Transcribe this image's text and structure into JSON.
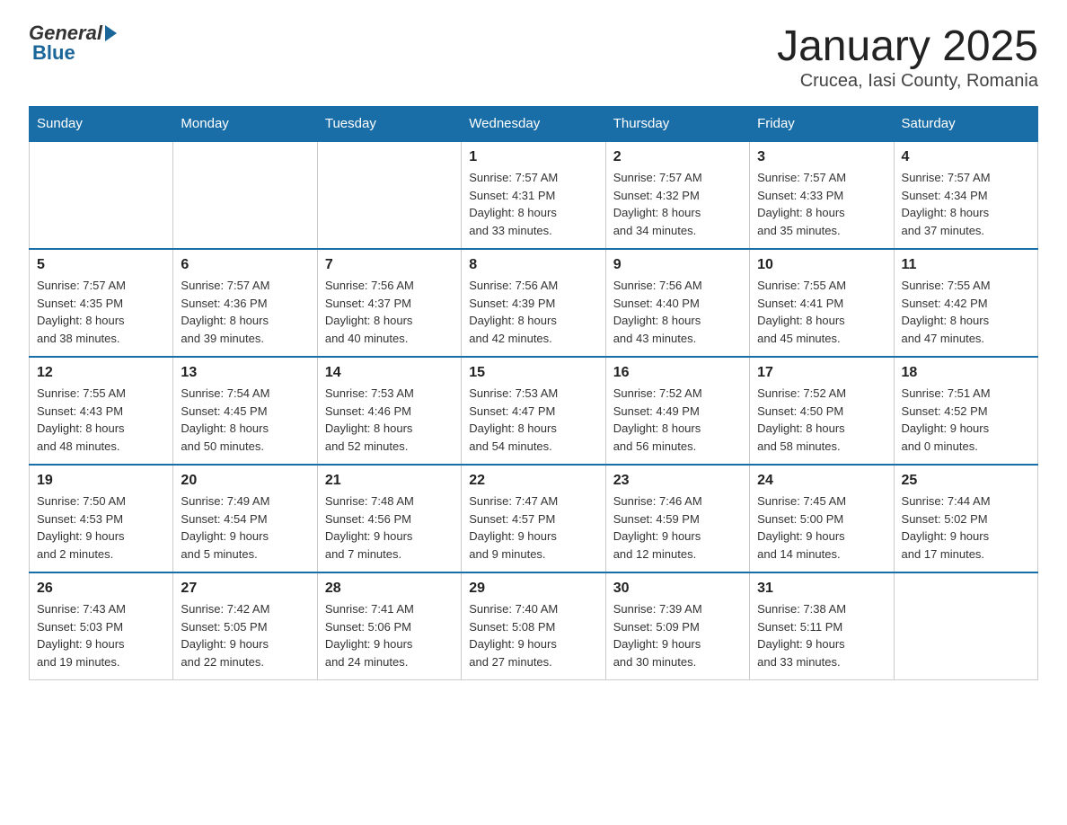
{
  "header": {
    "logo_general": "General",
    "logo_blue": "Blue",
    "title": "January 2025",
    "subtitle": "Crucea, Iasi County, Romania"
  },
  "days_of_week": [
    "Sunday",
    "Monday",
    "Tuesday",
    "Wednesday",
    "Thursday",
    "Friday",
    "Saturday"
  ],
  "weeks": [
    [
      {
        "day": "",
        "info": ""
      },
      {
        "day": "",
        "info": ""
      },
      {
        "day": "",
        "info": ""
      },
      {
        "day": "1",
        "info": "Sunrise: 7:57 AM\nSunset: 4:31 PM\nDaylight: 8 hours\nand 33 minutes."
      },
      {
        "day": "2",
        "info": "Sunrise: 7:57 AM\nSunset: 4:32 PM\nDaylight: 8 hours\nand 34 minutes."
      },
      {
        "day": "3",
        "info": "Sunrise: 7:57 AM\nSunset: 4:33 PM\nDaylight: 8 hours\nand 35 minutes."
      },
      {
        "day": "4",
        "info": "Sunrise: 7:57 AM\nSunset: 4:34 PM\nDaylight: 8 hours\nand 37 minutes."
      }
    ],
    [
      {
        "day": "5",
        "info": "Sunrise: 7:57 AM\nSunset: 4:35 PM\nDaylight: 8 hours\nand 38 minutes."
      },
      {
        "day": "6",
        "info": "Sunrise: 7:57 AM\nSunset: 4:36 PM\nDaylight: 8 hours\nand 39 minutes."
      },
      {
        "day": "7",
        "info": "Sunrise: 7:56 AM\nSunset: 4:37 PM\nDaylight: 8 hours\nand 40 minutes."
      },
      {
        "day": "8",
        "info": "Sunrise: 7:56 AM\nSunset: 4:39 PM\nDaylight: 8 hours\nand 42 minutes."
      },
      {
        "day": "9",
        "info": "Sunrise: 7:56 AM\nSunset: 4:40 PM\nDaylight: 8 hours\nand 43 minutes."
      },
      {
        "day": "10",
        "info": "Sunrise: 7:55 AM\nSunset: 4:41 PM\nDaylight: 8 hours\nand 45 minutes."
      },
      {
        "day": "11",
        "info": "Sunrise: 7:55 AM\nSunset: 4:42 PM\nDaylight: 8 hours\nand 47 minutes."
      }
    ],
    [
      {
        "day": "12",
        "info": "Sunrise: 7:55 AM\nSunset: 4:43 PM\nDaylight: 8 hours\nand 48 minutes."
      },
      {
        "day": "13",
        "info": "Sunrise: 7:54 AM\nSunset: 4:45 PM\nDaylight: 8 hours\nand 50 minutes."
      },
      {
        "day": "14",
        "info": "Sunrise: 7:53 AM\nSunset: 4:46 PM\nDaylight: 8 hours\nand 52 minutes."
      },
      {
        "day": "15",
        "info": "Sunrise: 7:53 AM\nSunset: 4:47 PM\nDaylight: 8 hours\nand 54 minutes."
      },
      {
        "day": "16",
        "info": "Sunrise: 7:52 AM\nSunset: 4:49 PM\nDaylight: 8 hours\nand 56 minutes."
      },
      {
        "day": "17",
        "info": "Sunrise: 7:52 AM\nSunset: 4:50 PM\nDaylight: 8 hours\nand 58 minutes."
      },
      {
        "day": "18",
        "info": "Sunrise: 7:51 AM\nSunset: 4:52 PM\nDaylight: 9 hours\nand 0 minutes."
      }
    ],
    [
      {
        "day": "19",
        "info": "Sunrise: 7:50 AM\nSunset: 4:53 PM\nDaylight: 9 hours\nand 2 minutes."
      },
      {
        "day": "20",
        "info": "Sunrise: 7:49 AM\nSunset: 4:54 PM\nDaylight: 9 hours\nand 5 minutes."
      },
      {
        "day": "21",
        "info": "Sunrise: 7:48 AM\nSunset: 4:56 PM\nDaylight: 9 hours\nand 7 minutes."
      },
      {
        "day": "22",
        "info": "Sunrise: 7:47 AM\nSunset: 4:57 PM\nDaylight: 9 hours\nand 9 minutes."
      },
      {
        "day": "23",
        "info": "Sunrise: 7:46 AM\nSunset: 4:59 PM\nDaylight: 9 hours\nand 12 minutes."
      },
      {
        "day": "24",
        "info": "Sunrise: 7:45 AM\nSunset: 5:00 PM\nDaylight: 9 hours\nand 14 minutes."
      },
      {
        "day": "25",
        "info": "Sunrise: 7:44 AM\nSunset: 5:02 PM\nDaylight: 9 hours\nand 17 minutes."
      }
    ],
    [
      {
        "day": "26",
        "info": "Sunrise: 7:43 AM\nSunset: 5:03 PM\nDaylight: 9 hours\nand 19 minutes."
      },
      {
        "day": "27",
        "info": "Sunrise: 7:42 AM\nSunset: 5:05 PM\nDaylight: 9 hours\nand 22 minutes."
      },
      {
        "day": "28",
        "info": "Sunrise: 7:41 AM\nSunset: 5:06 PM\nDaylight: 9 hours\nand 24 minutes."
      },
      {
        "day": "29",
        "info": "Sunrise: 7:40 AM\nSunset: 5:08 PM\nDaylight: 9 hours\nand 27 minutes."
      },
      {
        "day": "30",
        "info": "Sunrise: 7:39 AM\nSunset: 5:09 PM\nDaylight: 9 hours\nand 30 minutes."
      },
      {
        "day": "31",
        "info": "Sunrise: 7:38 AM\nSunset: 5:11 PM\nDaylight: 9 hours\nand 33 minutes."
      },
      {
        "day": "",
        "info": ""
      }
    ]
  ]
}
